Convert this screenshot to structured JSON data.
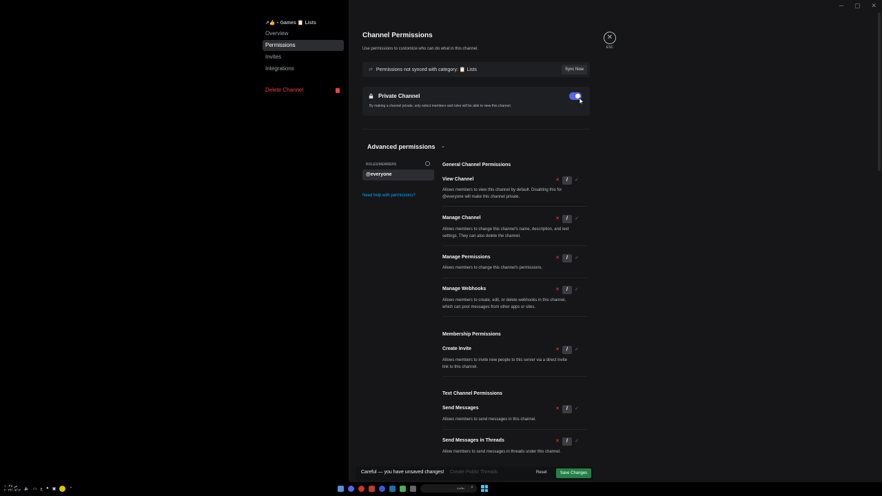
{
  "sidebar": {
    "category": "↗︎👍・Games 📋 Lists",
    "items": [
      {
        "label": "Overview",
        "active": false
      },
      {
        "label": "Permissions",
        "active": true
      },
      {
        "label": "Invites",
        "active": false
      },
      {
        "label": "Integrations",
        "active": false
      }
    ],
    "delete_label": "Delete Channel"
  },
  "header": {
    "title": "Channel Permissions",
    "subtitle": "Use permissions to customize who can do what in this channel.",
    "esc_label": "ESC"
  },
  "sync": {
    "text": "Permissions not synced with category: 📋 Lists",
    "button": "Sync Now"
  },
  "private_channel": {
    "title": "Private Channel",
    "description": "By making a channel private, only select members and roles will be able to view this channel.",
    "enabled": true
  },
  "advanced": {
    "title": "Advanced permissions",
    "roles_header": "ROLES/MEMBERS",
    "roles": [
      "@everyone"
    ],
    "help_link": "Need help with permissions?"
  },
  "sections": {
    "general": "General Channel Permissions",
    "membership": "Membership Permissions",
    "text": "Text Channel Permissions"
  },
  "permissions": [
    {
      "name": "View Channel",
      "desc1": "Allows members to view this channel by default. Disabling this for",
      "desc2": "@everyone will make this channel private.",
      "state": "neutral"
    },
    {
      "name": "Manage Channel",
      "desc1": "Allows members to change this channel's name, description, and text",
      "desc2": "settings. They can also delete the channel.",
      "state": "neutral"
    },
    {
      "name": "Manage Permissions",
      "desc1": "Allows members to change this channel's permissions.",
      "desc2": "",
      "state": "neutral"
    },
    {
      "name": "Manage Webhooks",
      "desc1": "Allows members to create, edit, or delete webhooks in this channel,",
      "desc2": "which can post messages from other apps or sites.",
      "state": "neutral"
    },
    {
      "name": "Create Invite",
      "desc1": "Allows members to invite new people to this server via a direct invite",
      "desc2": "link to this channel.",
      "state": "neutral"
    },
    {
      "name": "Send Messages",
      "desc1": "Allows members to send messages in this channel.",
      "desc2": "",
      "state": "neutral"
    },
    {
      "name": "Send Messages in Threads",
      "desc1": "Allow members to send messages in threads under this channel.",
      "desc2": "",
      "state": "neutral"
    }
  ],
  "perm_glyphs": {
    "deny": "✕",
    "neutral": "/",
    "allow": "✓"
  },
  "unsaved": {
    "text": "Careful — you have unsaved changes!",
    "ghost": "Create Public Threads",
    "reset": "Reset",
    "save": "Save Changes"
  },
  "taskbar": {
    "time": "۱۰:۴۵ ص",
    "date": "۲۰۲۴/۰۷/۱۲",
    "lang": "ع",
    "search_placeholder": "بحث"
  },
  "colors": {
    "accent": "#5865f2",
    "danger": "#f23f43",
    "success": "#248046",
    "link": "#00a8fc"
  }
}
